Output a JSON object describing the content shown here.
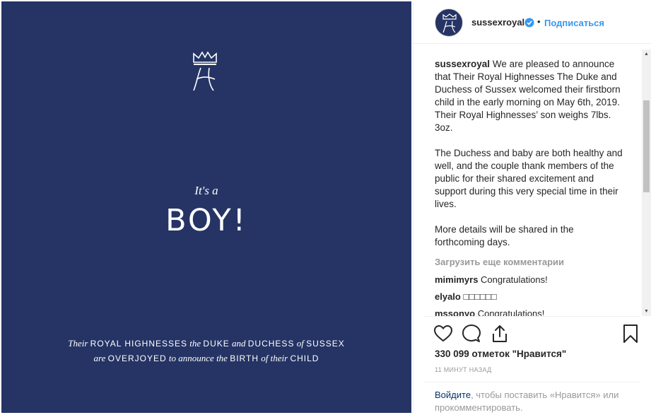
{
  "image": {
    "tagline": "It's a",
    "headline": "BOY!",
    "line1": [
      {
        "t": "Their",
        "s": "i"
      },
      {
        "t": "ROYAL HIGHNESSES",
        "s": "c"
      },
      {
        "t": "the",
        "s": "i"
      },
      {
        "t": "DUKE",
        "s": "c"
      },
      {
        "t": "and",
        "s": "i"
      },
      {
        "t": "DUCHESS",
        "s": "c"
      },
      {
        "t": "of",
        "s": "i"
      },
      {
        "t": "SUSSEX",
        "s": "c"
      }
    ],
    "line2": [
      {
        "t": "are",
        "s": "i"
      },
      {
        "t": "OVERJOYED",
        "s": "c"
      },
      {
        "t": "to announce the",
        "s": "i"
      },
      {
        "t": "BIRTH",
        "s": "c"
      },
      {
        "t": "of their",
        "s": "i"
      },
      {
        "t": "CHILD",
        "s": "c"
      }
    ]
  },
  "header": {
    "username": "sussexroyal",
    "dot": "•",
    "follow_label": "Подписаться"
  },
  "caption": {
    "username": "sussexroyal",
    "paragraph1": "We are pleased to announce that Their Royal Highnesses The Duke and Duchess of Sussex welcomed their firstborn child in the early morning on May 6th, 2019. Their Royal Highnesses’ son weighs 7lbs. 3oz.",
    "paragraph2": "The Duchess and baby are both healthy and well, and the couple thank members of the public for their shared excitement and support during this very special time in their lives.",
    "paragraph3": "More details will be shared in the forthcoming days."
  },
  "load_more_label": "Загрузить еще комментарии",
  "comments": [
    {
      "user": "mimimyrs",
      "text": "Congratulations!"
    },
    {
      "user": "elyalo",
      "text": "□□□□□□"
    },
    {
      "user": "mssonyo",
      "text": "Congratulations!"
    }
  ],
  "scrollbar": {
    "up_arrow": "▲",
    "down_arrow": "▼"
  },
  "likes_text": "330 099 отметок \"Нравится\"",
  "timestamp": "11 МИНУТ НАЗАД",
  "login": {
    "link": "Войдите",
    "rest": ", чтобы поставить «Нравится» или прокомментировать."
  },
  "icons": {
    "like": "heart-icon",
    "comment": "speech-bubble-icon",
    "share": "share-arrow-icon",
    "save": "bookmark-icon",
    "verified": "verified-badge-icon"
  },
  "colors": {
    "image_background": "#253465",
    "follow_link": "#3897f0",
    "verified_badge": "#3897f0",
    "login_link": "#003569"
  }
}
